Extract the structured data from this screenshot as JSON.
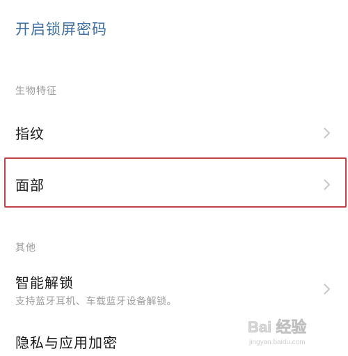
{
  "header": {
    "enable_lock_password": "开启锁屏密码"
  },
  "sections": {
    "biometrics": {
      "title": "生物特征",
      "items": [
        {
          "label": "指纹"
        },
        {
          "label": "面部"
        }
      ]
    },
    "other": {
      "title": "其他",
      "items": [
        {
          "label": "智能解锁",
          "subtitle": "支持蓝牙耳机、车载蓝牙设备解锁。"
        },
        {
          "label": "隐私与应用加密"
        }
      ]
    }
  },
  "watermark": {
    "text": "Bai 经验",
    "url": "jingyan.baidu.com"
  },
  "colors": {
    "link": "#3f6f9e",
    "section_header": "#9a9a9a",
    "highlight_border": "#c0434b",
    "chevron": "#c8c8c8"
  }
}
